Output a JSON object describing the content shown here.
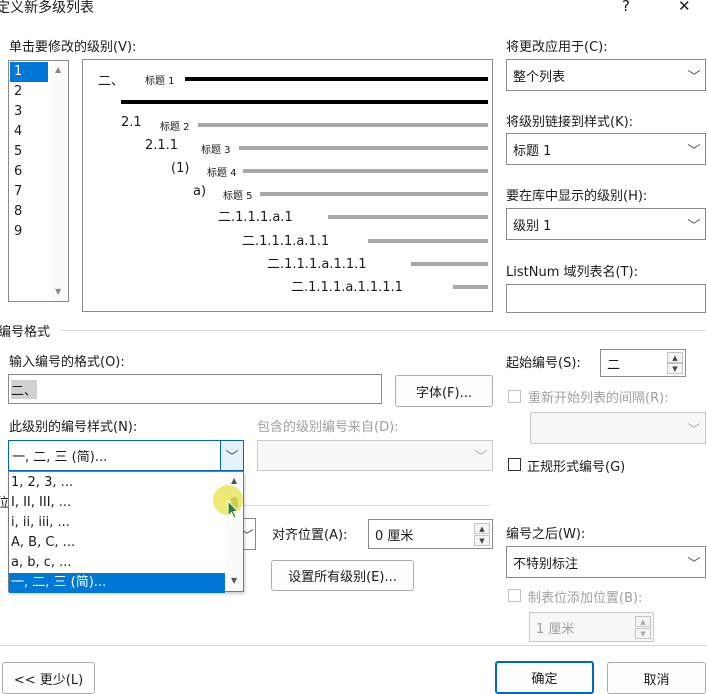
{
  "dialog": {
    "title": "定义新多级列表",
    "help": "?",
    "close": "✕"
  },
  "level_list": {
    "label": "单击要修改的级别(V):",
    "items": [
      "1",
      "2",
      "3",
      "4",
      "5",
      "6",
      "7",
      "8",
      "9"
    ],
    "selected": "1"
  },
  "preview": {
    "rows": [
      {
        "prefix": "二、",
        "text": "标题 1"
      },
      {
        "prefix": "2.1",
        "text": "标题 2"
      },
      {
        "prefix": "2.1.1",
        "text": "标题 3"
      },
      {
        "prefix": "(1)",
        "text": "标题 4"
      },
      {
        "prefix": "a)",
        "text": "标题 5"
      },
      {
        "prefix": "二.1.1.1.a.1",
        "text": ""
      },
      {
        "prefix": "二.1.1.1.a.1.1",
        "text": ""
      },
      {
        "prefix": "二.1.1.1.a.1.1.1",
        "text": ""
      },
      {
        "prefix": "二.1.1.1.a.1.1.1.1",
        "text": ""
      }
    ]
  },
  "apply_to": {
    "label": "将更改应用于(C):",
    "value": "整个列表"
  },
  "link_style": {
    "label": "将级别链接到样式(K):",
    "value": "标题 1"
  },
  "gallery_level": {
    "label": "要在库中显示的级别(H):",
    "value": "级别 1"
  },
  "listnum": {
    "label": "ListNum 域列表名(T):",
    "value": ""
  },
  "number_format": {
    "section": "编号格式",
    "input_label": "输入编号的格式(O):",
    "input_value": "二、",
    "font_button": "字体(F)...",
    "style_label": "此级别的编号样式(N):",
    "style_value": "一, 二, 三 (简)...",
    "include_label": "包含的级别编号来自(D):",
    "include_value": ""
  },
  "start_at": {
    "label": "起始编号(S):",
    "value": "二"
  },
  "restart": {
    "label": "重新开始列表的间隔(R):",
    "value": ""
  },
  "legal": {
    "label": "正规形式编号(G)"
  },
  "dropdown_options": [
    "1, 2, 3, ...",
    "I, II, III, ...",
    "i, ii, iii, ...",
    "A, B, C, ...",
    "a, b, c, ...",
    "一, 二, 三 (简)..."
  ],
  "dropdown_selected_index": 5,
  "position": {
    "partial_label": "位",
    "align_label": "对齐位置(A):",
    "align_value": "0 厘米",
    "set_all_button": "设置所有级别(E)..."
  },
  "follow": {
    "label": "编号之后(W):",
    "value": "不特别标注"
  },
  "tab_stop": {
    "label": "制表位添加位置(B):",
    "value": "1 厘米"
  },
  "footer": {
    "less_button": "<< 更少(L)",
    "ok_button": "确定",
    "cancel_button": "取消"
  },
  "colors": {
    "accent": "#0067c0",
    "selection": "#0078d7",
    "cursor": "#e6e14a"
  }
}
